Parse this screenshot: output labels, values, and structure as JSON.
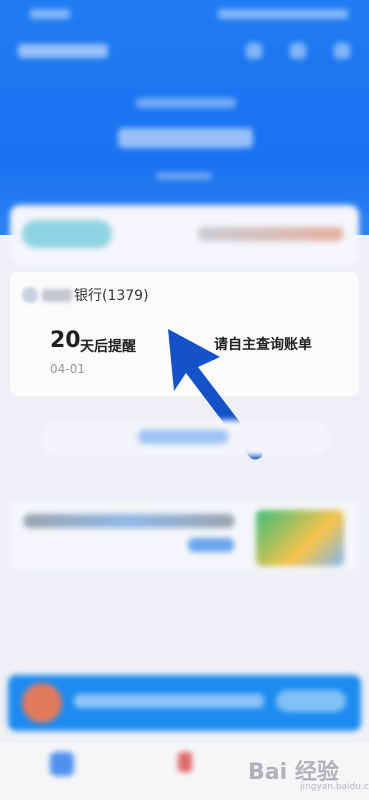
{
  "card": {
    "bank_name": "银行(1379)",
    "days_number": "20",
    "days_label": "天后提醒",
    "date": "04-01",
    "hint": "请自主查询账单"
  },
  "watermark": {
    "text": "Bai 经验",
    "sub": "jingyan.baidu.com"
  },
  "colors": {
    "header_blue": "#1f7cf2",
    "arrow_blue": "#1452c8",
    "banner_blue": "#1d8bf0"
  }
}
